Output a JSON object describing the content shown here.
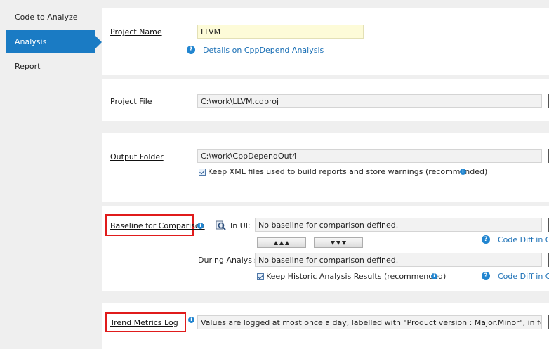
{
  "sidebar": {
    "items": [
      {
        "label": "Code to Analyze",
        "active": false
      },
      {
        "label": "Analysis",
        "active": true
      },
      {
        "label": "Report",
        "active": false
      }
    ]
  },
  "project_name": {
    "label": "Project Name",
    "value": "LLVM",
    "details_link": "Details on CppDepend Analysis"
  },
  "project_file": {
    "label": "Project File",
    "value": "C:\\work\\LLVM.cdproj"
  },
  "output_folder": {
    "label": "Output Folder",
    "value": "C:\\work\\CppDependOut4",
    "keep_xml_label": "Keep XML files used to build reports and store warnings (recommended)"
  },
  "baseline": {
    "label": "Baseline for Comparison",
    "in_ui_label": "In UI:",
    "in_ui_value": "No baseline for comparison defined.",
    "code_diff_link": "Code Diff in Cp",
    "during_label": "During Analysis:",
    "during_value": "No baseline for comparison defined.",
    "keep_historic_label": "Keep Historic Analysis Results (recommended)",
    "code_diff_link_2": "Code Diff in Cp"
  },
  "trend": {
    "label": "Trend Metrics Log",
    "value": "Values are logged at most once a day, labelled with \"Product version : Major.Minor\", in folder \"$Projec"
  },
  "colors": {
    "accent": "#1a7bc4",
    "highlight_box": "#e01b1b",
    "link": "#1a6fb5"
  }
}
